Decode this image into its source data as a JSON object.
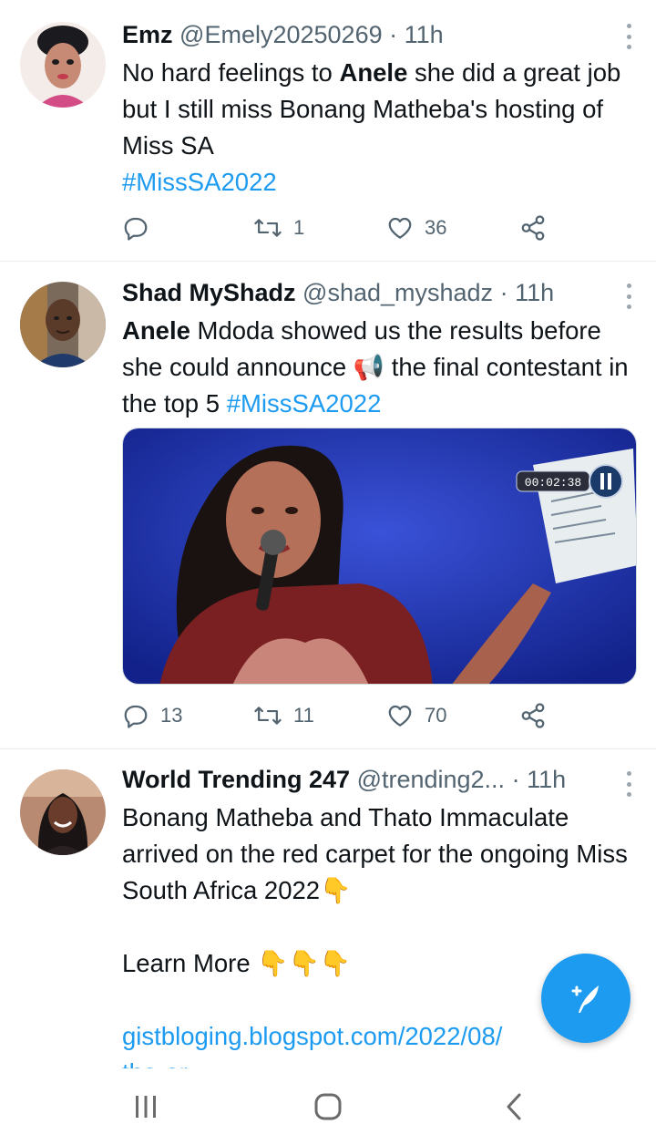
{
  "colors": {
    "accent": "#1d9bf0",
    "text": "#0f1419",
    "muted": "#536471",
    "divider": "#e6ecf0"
  },
  "tweets": [
    {
      "name": "Emz",
      "handle": "@Emely20250269",
      "time": "· 11h",
      "text_pre": "No hard feelings to ",
      "text_bold": "Anele",
      "text_post": " she did a great job but I still miss Bonang Matheba's hosting of Miss SA",
      "hashtag": "#MissSA2022",
      "replies": "",
      "retweets": "1",
      "likes": "36"
    },
    {
      "name": "Shad MyShadz",
      "handle": "@shad_myshadz",
      "time": "· 11h",
      "text_bold": "Anele",
      "text_post_a": " Mdoda showed us the results before she could announce ",
      "emoji": "📢",
      "text_post_b": " the final contestant in the top 5 ",
      "hashtag": "#MissSA2022",
      "timer": "00:02:38",
      "replies": "13",
      "retweets": "11",
      "likes": "70"
    },
    {
      "name": "World Trending 247",
      "handle": "@trending2...",
      "time": "· 11h",
      "text_a": "Bonang Matheba and Thato Immaculate arrived on the red carpet for the ongoing Miss South Africa 2022",
      "emoji_a": "👇",
      "learn_more": "Learn More",
      "emoji_b": "👇👇👇",
      "link": "gistbloging.blogspot.com/2022/08/",
      "link_cut": "the-or"
    }
  ],
  "icons": {
    "reply": "reply-icon",
    "retweet": "retweet-icon",
    "like": "heart-icon",
    "share": "share-icon",
    "compose": "compose-tweet-icon",
    "nav_recents": "recents-icon",
    "nav_home": "home-icon",
    "nav_back": "back-icon"
  }
}
